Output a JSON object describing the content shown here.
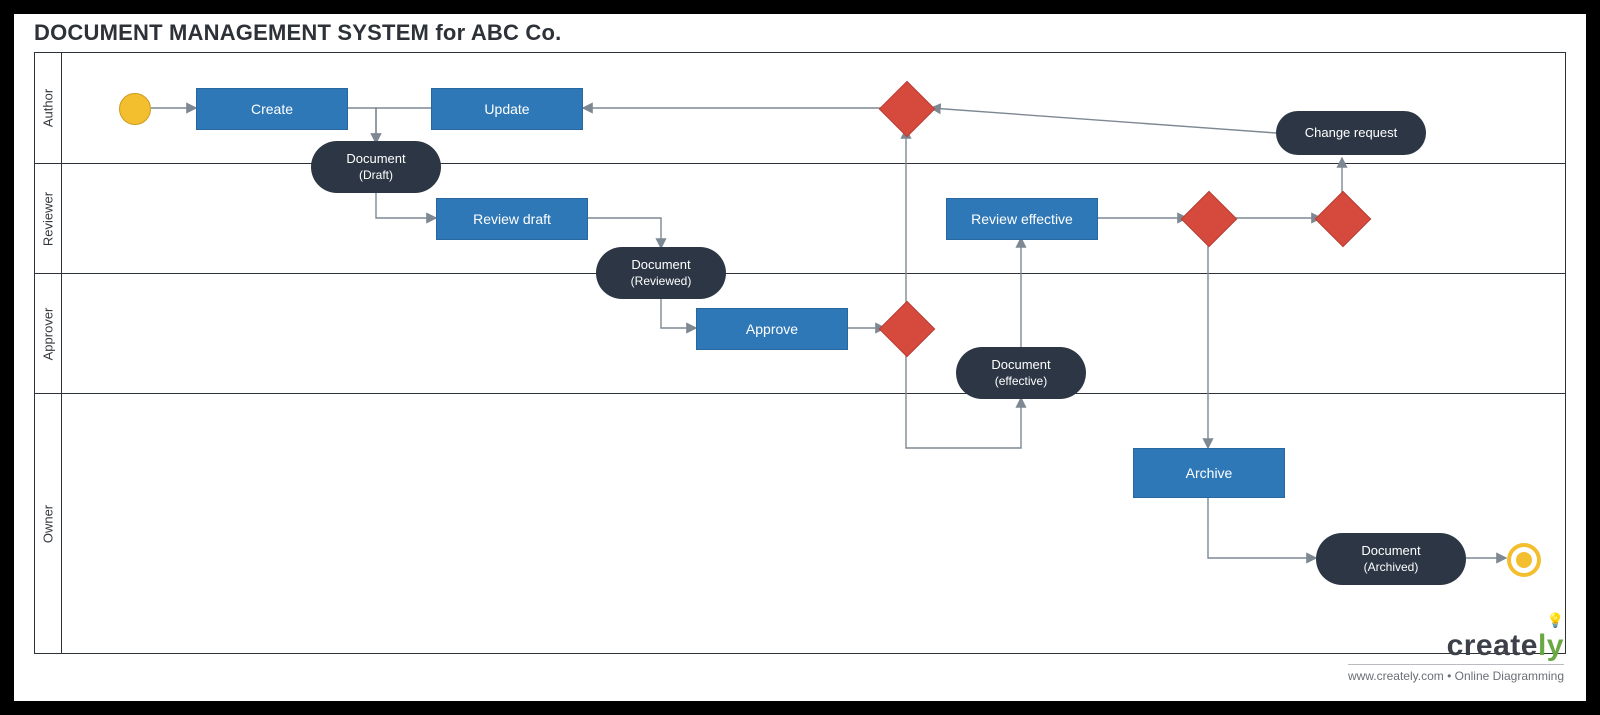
{
  "title": "DOCUMENT MANAGEMENT SYSTEM for ABC Co.",
  "lanes": {
    "author": {
      "label": "Author"
    },
    "reviewer": {
      "label": "Reviewer"
    },
    "approver": {
      "label": "Approver"
    },
    "owner": {
      "label": "Owner"
    }
  },
  "activities": {
    "create": {
      "label": "Create"
    },
    "update": {
      "label": "Update"
    },
    "review_draft": {
      "label": "Review draft"
    },
    "review_effective": {
      "label": "Review effective"
    },
    "approve": {
      "label": "Approve"
    },
    "archive": {
      "label": "Archive"
    },
    "change_request": {
      "label": "Change request"
    }
  },
  "docs": {
    "draft": {
      "l1": "Document",
      "l2": "(Draft)"
    },
    "reviewed": {
      "l1": "Document",
      "l2": "(Reviewed)"
    },
    "effective": {
      "l1": "Document",
      "l2": "(effective)"
    },
    "archived": {
      "l1": "Document",
      "l2": "(Archived)"
    }
  },
  "branding": {
    "logo_a": "create",
    "logo_b": "ly",
    "tagline": "www.creately.com • Online Diagramming"
  }
}
